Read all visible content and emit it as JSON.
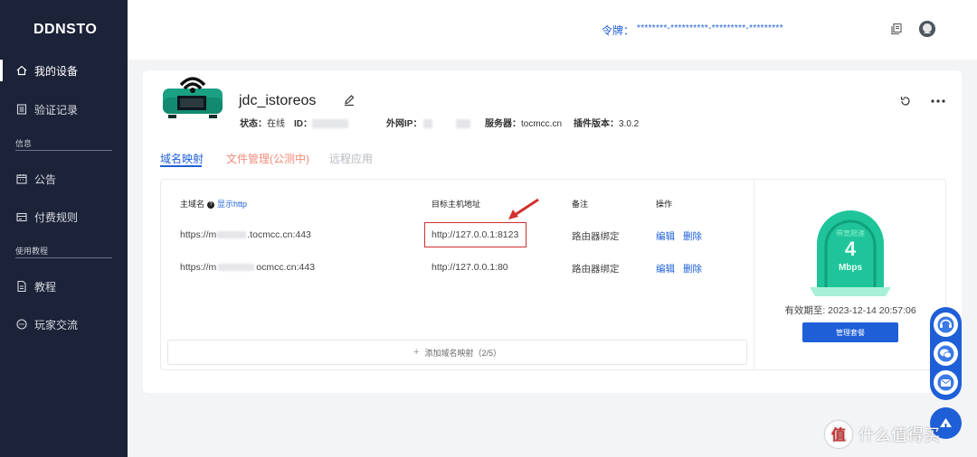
{
  "sidebar": {
    "brand": "DDNSTO",
    "items": [
      {
        "label": "我的设备",
        "icon": "home-icon",
        "active": true
      },
      {
        "label": "验证记录",
        "icon": "document-icon"
      },
      {
        "label": "公告",
        "icon": "calendar-icon"
      },
      {
        "label": "付费规则",
        "icon": "card-icon"
      },
      {
        "label": "教程",
        "icon": "file-icon"
      },
      {
        "label": "玩家交流",
        "icon": "chat-icon"
      }
    ],
    "sections": [
      "信息",
      "使用教程"
    ]
  },
  "topbar": {
    "token_label": "令牌：",
    "token_value": "********-**********-*********-*********"
  },
  "device": {
    "name": "jdc_istoreos",
    "status_label": "状态：",
    "status_value": "在线",
    "id_label": "ID：",
    "ip_label": "外网IP：",
    "server_label": "服务器：",
    "server_value": "tocmcc.cn",
    "plugin_label": "插件版本：",
    "plugin_value": "3.0.2"
  },
  "tabs": [
    {
      "label": "域名映射",
      "state": "active"
    },
    {
      "label": "文件管理(公测中)",
      "state": "beta"
    },
    {
      "label": "远程应用",
      "state": "disabled"
    }
  ],
  "table": {
    "headers": {
      "domain": "主域名",
      "show_http": "显示http",
      "target": "目标主机地址",
      "note": "备注",
      "action": "操作"
    },
    "rows": [
      {
        "domain_prefix": "https://m",
        "domain_suffix": ".tocmcc.cn:443",
        "target": "http://127.0.0.1:8123",
        "note": "路由器绑定",
        "edit": "编辑",
        "delete": "删除"
      },
      {
        "domain_prefix": "https://m",
        "domain_suffix": "ocmcc.cn:443",
        "target": "http://127.0.0.1:80",
        "note": "路由器绑定",
        "edit": "编辑",
        "delete": "删除"
      }
    ],
    "add_label": "添加域名映射（2/5）"
  },
  "plan": {
    "gauge_label": "带宽限速",
    "gauge_value": "4",
    "gauge_unit": "Mbps",
    "expiry": "有效期至: 2023-12-14 20:57:06",
    "manage_label": "管理套餐"
  },
  "watermark": "什么值得买",
  "colors": {
    "sidebar_bg": "#1c2238",
    "accent": "#1e5fd8",
    "gauge": "#1fc49a",
    "highlight": "#d32f2f"
  }
}
